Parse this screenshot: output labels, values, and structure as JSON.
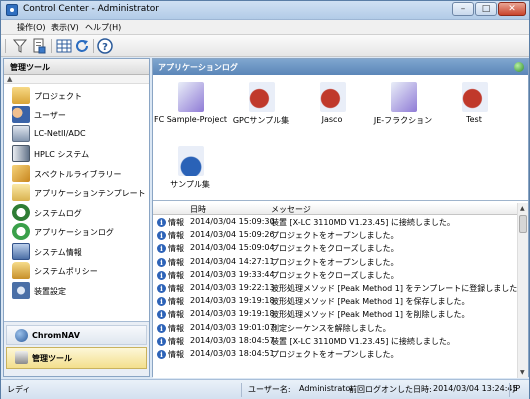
{
  "window": {
    "title": "Control Center - Administrator",
    "min": "–",
    "max": "□",
    "close": "✕"
  },
  "menu": [
    "操作(O)",
    "表示(V)",
    "ヘルプ(H)"
  ],
  "toolbar_icons": [
    "filter-icon",
    "document-icon",
    "grid-icon",
    "refresh-icon",
    "help-icon"
  ],
  "left": {
    "header": "管理ツール",
    "scroll_hint": "▲",
    "tools": [
      {
        "label": "プロジェクト",
        "icon": "folder-icon",
        "color": "#e2b547"
      },
      {
        "label": "ユーザー",
        "icon": "users-icon",
        "color": "#d27b3f"
      },
      {
        "label": "LC-NetII/ADC",
        "icon": "network-icon",
        "color": "#7b8fa8"
      },
      {
        "label": "HPLC システム",
        "icon": "hplc-icon",
        "color": "#5c6d82"
      },
      {
        "label": "スペクトルライブラリー",
        "icon": "library-icon",
        "color": "#d9a23b"
      },
      {
        "label": "アプリケーションテンプレート",
        "icon": "template-icon",
        "color": "#e6c86e"
      },
      {
        "label": "システムログ",
        "icon": "system-log-icon",
        "color": "#3f8f3f"
      },
      {
        "label": "アプリケーションログ",
        "icon": "app-log-icon",
        "color": "#3c9a4b"
      },
      {
        "label": "システム情報",
        "icon": "monitor-icon",
        "color": "#5577aa"
      },
      {
        "label": "システムポリシー",
        "icon": "lock-icon",
        "color": "#d6a43a"
      },
      {
        "label": "装置設定",
        "icon": "gear-icon",
        "color": "#4a6fa7"
      }
    ],
    "nav": [
      {
        "label": "ChromNAV",
        "icon": "chromnav-icon"
      },
      {
        "label": "管理ツール",
        "icon": "admin-tools-icon"
      }
    ]
  },
  "right": {
    "header": "アプリケーションログ",
    "apps": [
      {
        "label": "FC Sample-Project"
      },
      {
        "label": "GPCサンプル集"
      },
      {
        "label": "Jasco"
      },
      {
        "label": "JE-フラクション"
      },
      {
        "label": "Test"
      },
      {
        "label": "サンプル集"
      }
    ],
    "log_headers": {
      "datetime": "日時",
      "message": "メッセージ"
    },
    "log": [
      {
        "level": "情報",
        "time": "2014/03/04 15:09:30",
        "message": "装置 [X-LC 3110MD V1.23.45] に接続しました。"
      },
      {
        "level": "情報",
        "time": "2014/03/04 15:09:26",
        "message": "プロジェクトをオープンしました。"
      },
      {
        "level": "情報",
        "time": "2014/03/04 15:09:04",
        "message": "プロジェクトをクローズしました。"
      },
      {
        "level": "情報",
        "time": "2014/03/04 14:27:11",
        "message": "プロジェクトをオープンしました。"
      },
      {
        "level": "情報",
        "time": "2014/03/03 19:33:44",
        "message": "プロジェクトをクローズしました。"
      },
      {
        "level": "情報",
        "time": "2014/03/03 19:22:13",
        "message": "波形処理メソッド [Peak Method 1] をテンプレートに登録しました。"
      },
      {
        "level": "情報",
        "time": "2014/03/03 19:19:18",
        "message": "波形処理メソッド [Peak Method 1] を保存しました。"
      },
      {
        "level": "情報",
        "time": "2014/03/03 19:19:18",
        "message": "波形処理メソッド [Peak Method 1] を削除しました。"
      },
      {
        "level": "情報",
        "time": "2014/03/03 19:01:07",
        "message": "測定シーケンスを解除しました。"
      },
      {
        "level": "情報",
        "time": "2014/03/03 18:04:57",
        "message": "装置 [X-LC 3110MD V1.23.45] に接続しました。"
      },
      {
        "level": "情報",
        "time": "2014/03/03 18:04:51",
        "message": "プロジェクトをオープンしました。"
      }
    ]
  },
  "status": {
    "ready": "レディ",
    "user_label": "ユーザー名:",
    "user": "Administrator",
    "last_login_label": "前回ログオンした日時:",
    "last_login": "2014/03/04 13:24:45",
    "lang": "JP"
  }
}
